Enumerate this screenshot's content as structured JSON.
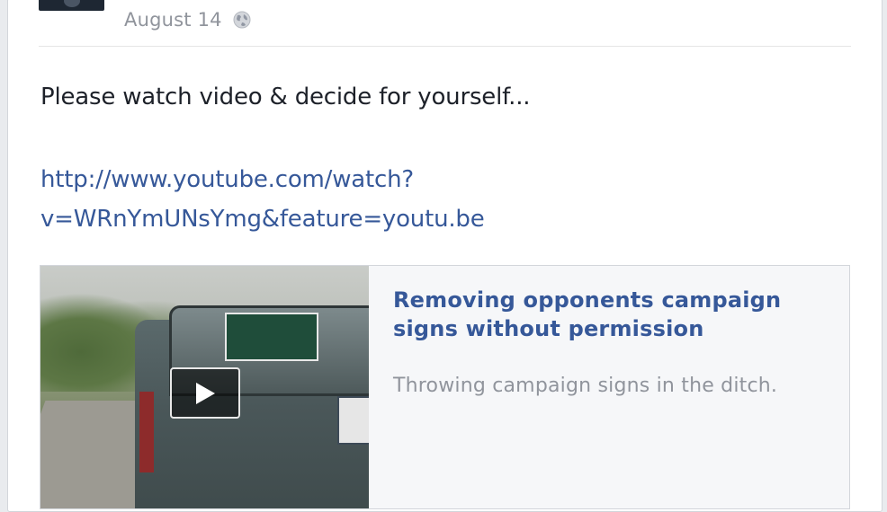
{
  "post": {
    "date": "August 14",
    "audience_icon": "globe-icon",
    "message": "Please watch video & decide for yourself...",
    "link_line1": "http://www.youtube.com/watch?",
    "link_line2": "v=WRnYmUNsYmg&feature=youtu.be"
  },
  "share": {
    "title": "Removing opponents campaign signs without permission",
    "description": "Throwing campaign signs in the ditch.",
    "play_icon": "play-icon"
  },
  "colors": {
    "link": "#365899",
    "meta": "#90949c",
    "text": "#1d2129"
  }
}
